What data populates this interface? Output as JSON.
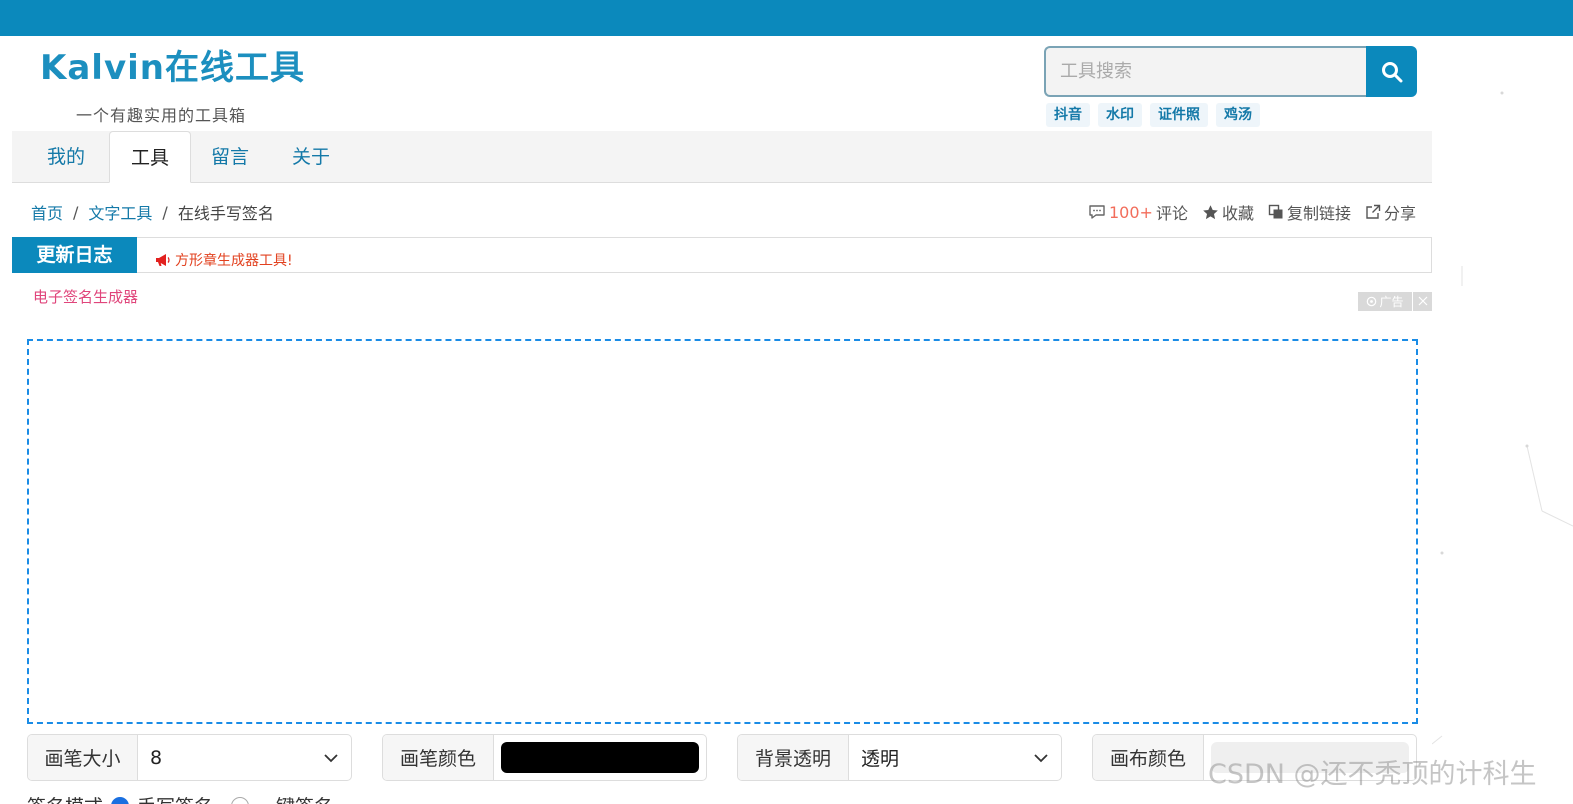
{
  "logo": {
    "main": "Kalvin在线工具",
    "tagline": "一个有趣实用的工具箱"
  },
  "search": {
    "placeholder": "工具搜索",
    "hot_tags": [
      "抖音",
      "水印",
      "证件照",
      "鸡汤"
    ]
  },
  "nav": {
    "items": [
      {
        "label": "我的"
      },
      {
        "label": "工具",
        "active": true
      },
      {
        "label": "留言"
      },
      {
        "label": "关于"
      }
    ]
  },
  "breadcrumb": {
    "home": "首页",
    "sep1": "/",
    "category": "文字工具",
    "sep2": "/",
    "current": "在线手写签名"
  },
  "actions": {
    "comment_count": "100+",
    "comment_label": "评论",
    "favorite": "收藏",
    "copy_link": "复制链接",
    "share": "分享"
  },
  "update": {
    "label": "更新日志",
    "message": "方形章生成器工具!"
  },
  "tool": {
    "subtitle": "电子签名生成器",
    "ad_label": "广告"
  },
  "controls": {
    "pen_size_label": "画笔大小",
    "pen_size_value": "8",
    "pen_color_label": "画笔颜色",
    "pen_color": "#000000",
    "bg_transparent_label": "背景透明",
    "bg_transparent_value": "透明",
    "canvas_color_label": "画布颜色",
    "canvas_color": "#efefef"
  },
  "mode": {
    "label": "签名模式",
    "options": [
      "手写签名",
      "一键签名"
    ],
    "selected": "手写签名"
  },
  "watermark": "CSDN @还不秃顶的计科生",
  "colors": {
    "brand": "#0b89bc",
    "link": "#1479a8",
    "dashed_border": "#1a8ce6",
    "accent_red": "#e2411f",
    "subtitle_pink": "#e0457b"
  }
}
